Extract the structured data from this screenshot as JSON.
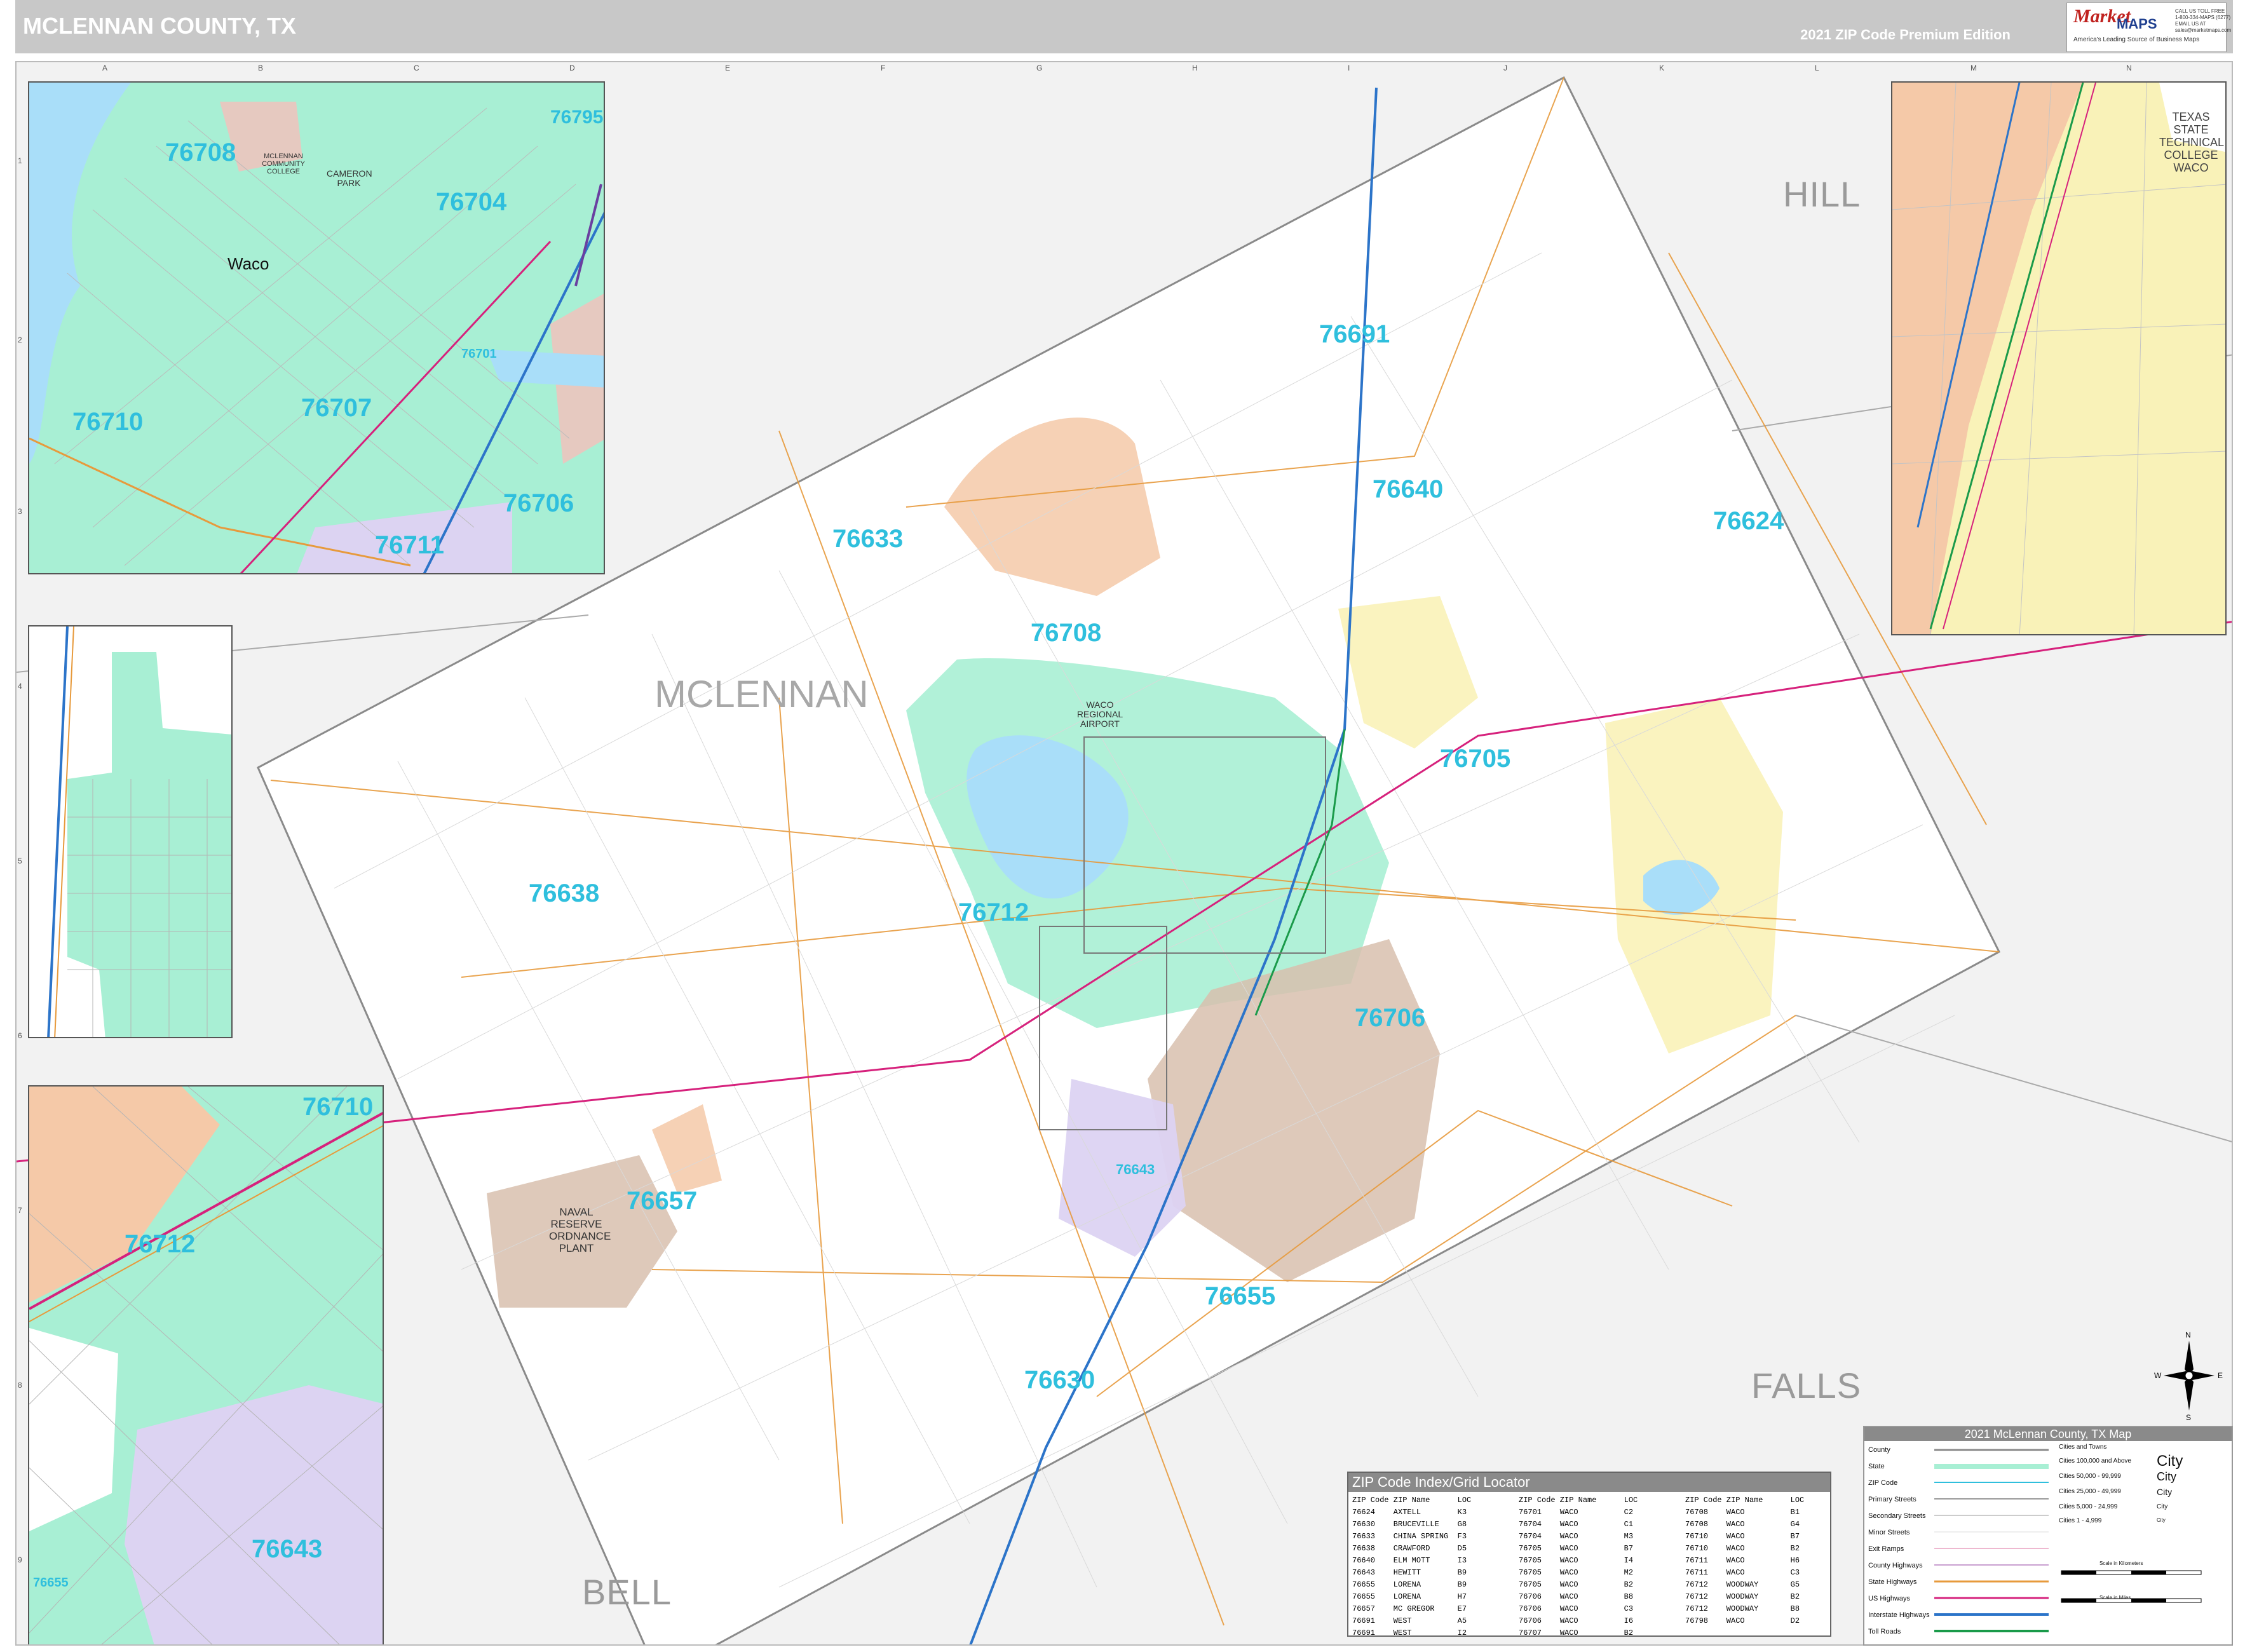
{
  "header": {
    "title": "MCLENNAN COUNTY, TX",
    "edition": "2021 ZIP Code Premium Edition"
  },
  "brand": {
    "logo_text": "Market",
    "maps_text": "MAPS",
    "tagline": "America's Leading Source of Business Maps",
    "contact": "CALL US TOLL FREE\n1-800-334-MAPS (6277)\nEMAIL US AT\nsales@marketmaps.com"
  },
  "grid": {
    "columns": [
      "A",
      "B",
      "C",
      "D",
      "E",
      "F",
      "G",
      "H",
      "I",
      "J",
      "K",
      "L",
      "M",
      "N"
    ],
    "rows": [
      "1",
      "2",
      "3",
      "4",
      "5",
      "6",
      "7",
      "8",
      "9"
    ]
  },
  "counties": {
    "main": "MCLENNAN",
    "hill": "HILL",
    "falls": "FALLS",
    "bell": "BELL"
  },
  "zips": [
    {
      "code": "76691"
    },
    {
      "code": "76640"
    },
    {
      "code": "76624"
    },
    {
      "code": "76633"
    },
    {
      "code": "76708"
    },
    {
      "code": "76705"
    },
    {
      "code": "76638"
    },
    {
      "code": "76712"
    },
    {
      "code": "76706"
    },
    {
      "code": "76657"
    },
    {
      "code": "76643"
    },
    {
      "code": "76655"
    },
    {
      "code": "76630"
    },
    {
      "code": "76711"
    }
  ],
  "places": {
    "waco_regional_airport": "WACO REGIONAL AIRPORT",
    "naval_reserve": "NAVAL RESERVE ORDNANCE PLANT",
    "texas_state_tech": "TEXAS STATE TECHNICAL COLLEGE WACO",
    "mclennan_cc": "MCLENNAN COMMUNITY COLLEGE",
    "cameron_park": "CAMERON PARK",
    "waco": "Waco"
  },
  "insets": {
    "waco": {
      "zips": [
        "76708",
        "76704",
        "76710",
        "76707",
        "76701",
        "76706",
        "76711",
        "76795"
      ]
    },
    "woodway": {
      "zips": [
        "76710",
        "76712",
        "76643",
        "76655"
      ]
    }
  },
  "zip_index": {
    "title": "ZIP Code Index/Grid Locator",
    "headers": [
      "ZIP Code",
      "ZIP Name",
      "LOC"
    ],
    "rows": [
      [
        "76624",
        "AXTELL",
        "K3"
      ],
      [
        "76630",
        "BRUCEVILLE",
        "G8"
      ],
      [
        "76633",
        "CHINA SPRING",
        "F3"
      ],
      [
        "76638",
        "CRAWFORD",
        "D5"
      ],
      [
        "76640",
        "ELM MOTT",
        "I3"
      ],
      [
        "76643",
        "HEWITT",
        "B9"
      ],
      [
        "76655",
        "LORENA",
        "B9"
      ],
      [
        "76655",
        "LORENA",
        "H7"
      ],
      [
        "76657",
        "MC GREGOR",
        "E7"
      ],
      [
        "76691",
        "WEST",
        "A5"
      ],
      [
        "76691",
        "WEST",
        "I2"
      ],
      [
        "76701",
        "WACO",
        "C2"
      ],
      [
        "76704",
        "WACO",
        "C1"
      ],
      [
        "76704",
        "WACO",
        "M3"
      ],
      [
        "76705",
        "WACO",
        "B7"
      ],
      [
        "76705",
        "WACO",
        "I4"
      ],
      [
        "76705",
        "WACO",
        "M2"
      ],
      [
        "76705",
        "WACO",
        "B2"
      ],
      [
        "76706",
        "WACO",
        "B8"
      ],
      [
        "76706",
        "WACO",
        "C3"
      ],
      [
        "76706",
        "WACO",
        "I6"
      ],
      [
        "76707",
        "WACO",
        "B2"
      ],
      [
        "76708",
        "WACO",
        "B1"
      ],
      [
        "76708",
        "WACO",
        "G4"
      ],
      [
        "76710",
        "WACO",
        "B7"
      ],
      [
        "76710",
        "WACO",
        "B2"
      ],
      [
        "76711",
        "WACO",
        "H6"
      ],
      [
        "76711",
        "WACO",
        "C3"
      ],
      [
        "76712",
        "WOODWAY",
        "G5"
      ],
      [
        "76712",
        "WOODWAY",
        "B2"
      ],
      [
        "76712",
        "WOODWAY",
        "B8"
      ],
      [
        "76798",
        "WACO",
        "D2"
      ]
    ]
  },
  "legend": {
    "title": "2021 McLennan County, TX Map",
    "items": [
      "County",
      "State",
      "ZIP Code",
      "Primary Streets",
      "Secondary Streets",
      "Minor Streets",
      "Exit Ramps",
      "County Highways",
      "State Highways",
      "US Highways",
      "Interstate Highways",
      "Toll Roads"
    ],
    "cities_header": "Cities and Towns",
    "sizes": [
      "Cities 100,000 and Above",
      "Cities 50,000 - 99,999",
      "Cities 25,000 - 49,999",
      "Cities 5,000 - 24,999",
      "Cities 1 - 4,999"
    ],
    "city_word": "City",
    "scale_km": "Scale in Kilometers",
    "scale_mi": "Scale in Miles"
  },
  "compass": {
    "n": "N",
    "s": "S",
    "e": "E",
    "w": "W"
  },
  "colors": {
    "zip_label": "#2fbfdd",
    "green_zone": "#a8efd4",
    "peach_zone": "#f5c9a8",
    "tan_zone": "#d8bfae",
    "yellow_zone": "#f9f2b8",
    "lavender_zone": "#dcd3f2",
    "water": "#a9def9",
    "interstate": "#2c74c9",
    "us_highway": "#d6217c",
    "state_highway": "#e79a3c"
  }
}
